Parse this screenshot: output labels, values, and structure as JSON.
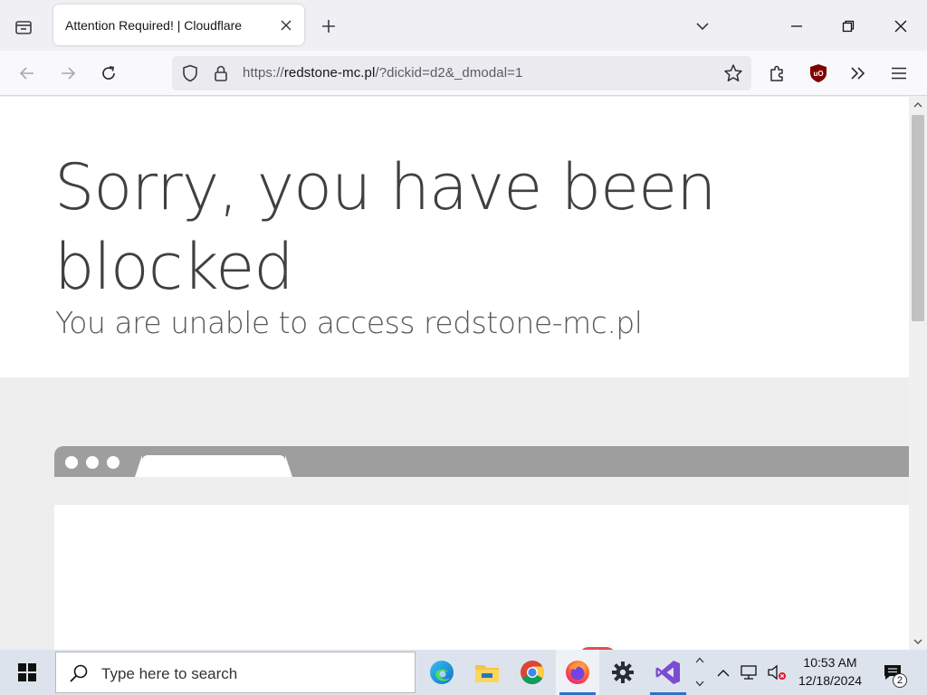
{
  "browser": {
    "tab": {
      "title": "Attention Required! | Cloudflare"
    },
    "url": {
      "host": "redstone-mc.pl",
      "prefix": "https://",
      "rest": "/?dickid=d2&_dmodal=1"
    }
  },
  "page": {
    "title": "Sorry, you have been blocked",
    "subtitle": "You are unable to access redstone-mc.pl"
  },
  "taskbar": {
    "search_placeholder": "Type here to search",
    "time": "10:53 AM",
    "date": "12/18/2024",
    "notification_count": "2",
    "apps": [
      "edge-icon",
      "file-explorer-icon",
      "chrome-icon",
      "firefox-icon",
      "settings-icon",
      "visual-studio-icon"
    ]
  },
  "colors": {
    "accent": "#2b73c9",
    "ublock": "#800000",
    "mock_bar": "#9e9e9e",
    "title_text": "#404040"
  }
}
